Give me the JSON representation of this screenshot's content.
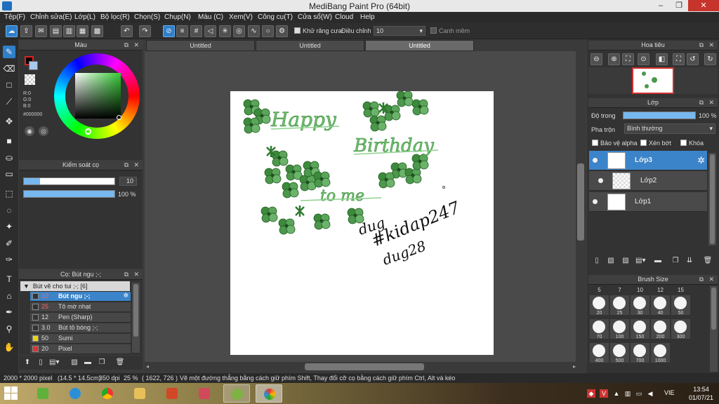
{
  "window": {
    "title": "MediBang Paint Pro (64bit)",
    "minimize": "–",
    "maximize": "❐",
    "close": "✕"
  },
  "menu": [
    "Tệp(F)",
    "Chỉnh sửa(E)",
    "Lớp(L)",
    "Bộ lọc(R)",
    "Chọn(S)",
    "Chụp(N)",
    "Màu (C)",
    "Xem(V)",
    "Công cụ(T)",
    "Cửa sổ(W)",
    "Cloud",
    "Help"
  ],
  "toolbar": {
    "antialias_label": "Khử răng cưa",
    "adjust_label": "Điều chỉnh",
    "adjust_value": "10",
    "canh_mem_label": "Canh mềm"
  },
  "color_panel": {
    "title": "Màu",
    "r": "R:0",
    "g": "G:0",
    "b": "B:0",
    "hex": "#000000",
    "fg_color": "#000000",
    "accent": "#2f7fc9"
  },
  "brush_control": {
    "title": "Kiểm soát cọ",
    "size_value": "10",
    "opacity_value": "100 %",
    "size_fraction": 0.18,
    "opacity_fraction": 1.0
  },
  "brush_panel": {
    "title": "Cọ: Bút ngu ;-;",
    "group": "Bút vẽ cho tui ;-; [6]",
    "items": [
      {
        "size": "10",
        "name": "Bút ngu ;-;",
        "color": "#333333"
      },
      {
        "size": "25",
        "name": "Tô mờ nhạt",
        "color": "#333333"
      },
      {
        "size": "12",
        "name": "Pen (Sharp)",
        "color": "#333333"
      },
      {
        "size": "3.0",
        "name": "Bút tô bóng ;-;",
        "color": "#333333"
      },
      {
        "size": "50",
        "name": "Sumi",
        "color": "#e8d51a"
      },
      {
        "size": "20",
        "name": "Pixel",
        "color": "#e03030"
      }
    ]
  },
  "tabs": [
    "Untitled",
    "Untitled",
    "Untitled"
  ],
  "navigator": {
    "title": "Hoa tiêu"
  },
  "layer_panel": {
    "title": "Lớp",
    "opacity_label": "Độ trong",
    "opacity_value": "100 %",
    "opacity_fraction": 1.0,
    "blend_label": "Pha trộn",
    "blend_value": "Bình thường",
    "protect_alpha": "Bảo vệ alpha",
    "clipping": "Xén bớt",
    "lock": "Khóa",
    "layers": [
      "Lớp3",
      "Lớp2",
      "Lớp1"
    ]
  },
  "brush_size": {
    "title": "Brush Size",
    "top_row": [
      "5",
      "7",
      "10",
      "12",
      "15"
    ],
    "rows": [
      [
        "20",
        "25",
        "30",
        "40",
        "50"
      ],
      [
        "70",
        "100",
        "150",
        "200",
        "300"
      ],
      [
        "400",
        "500",
        "700",
        "1000"
      ]
    ]
  },
  "canvas_art": {
    "text_happy": "Happy",
    "text_birthday": "Birthday",
    "text_to_me": "to me",
    "sig1": "dug",
    "sig2": "#kidap247",
    "sig3": "dug28"
  },
  "status": {
    "size": "2000 * 2000 pixel",
    "cm": "(14.5 * 14.5cm)",
    "dpi": "350 dpi",
    "zoom": "25 %",
    "coords": "( 1622, 726 )",
    "hint": "Vẽ một đường thẳng bằng cách giữ phím Shift, Thay đổi cỡ cọ bằng cách giữ phím Ctrl, Alt và kéo"
  },
  "taskbar": {
    "lang": "VIE",
    "time": "13:54",
    "date": "01/07/21"
  }
}
